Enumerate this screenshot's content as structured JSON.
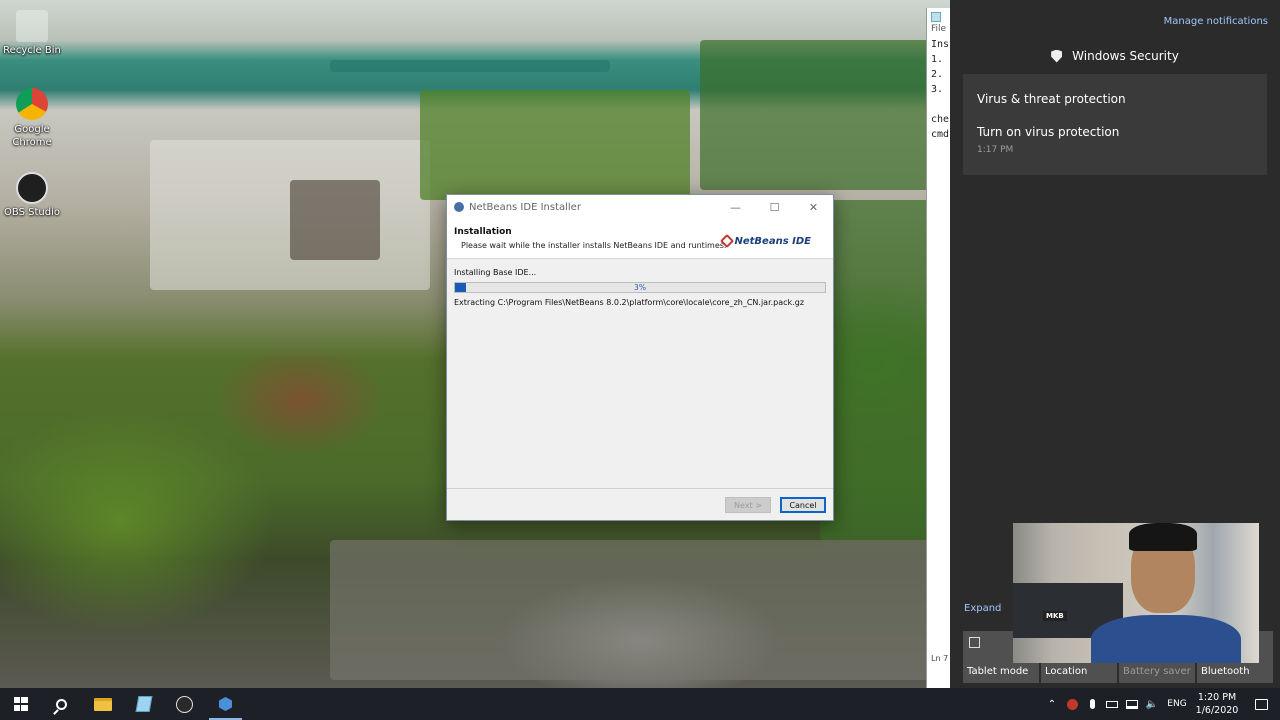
{
  "desktop": {
    "icons": [
      {
        "label": "Recycle Bin"
      },
      {
        "label": "Google Chrome"
      },
      {
        "label": "OBS Studio"
      }
    ]
  },
  "notepad": {
    "lines": [
      "File",
      "Ins",
      "1.",
      "2.",
      "3.",
      "",
      "che",
      "cmd"
    ],
    "status": "Ln 7"
  },
  "installer": {
    "title": "NetBeans IDE Installer",
    "header_title": "Installation",
    "header_subtitle": "Please wait while the installer installs NetBeans IDE and runtimes.",
    "logo_text": "NetBeans IDE",
    "status": "Installing Base IDE...",
    "progress_percent": 3,
    "progress_label": "3%",
    "detail": "Extracting C:\\Program Files\\NetBeans 8.0.2\\platform\\core\\locale\\core_zh_CN.jar.pack.gz",
    "next_label": "Next >",
    "cancel_label": "Cancel"
  },
  "action_center": {
    "manage_label": "Manage notifications",
    "app_name": "Windows Security",
    "notification_title": "Virus & threat protection",
    "notification_body": "Turn on virus protection",
    "notification_time": "1:17 PM",
    "expand_label": "Expand",
    "quick_actions": [
      {
        "label": "Tablet mode",
        "enabled": true
      },
      {
        "label": "Location",
        "enabled": true
      },
      {
        "label": "Battery saver",
        "enabled": false
      },
      {
        "label": "Bluetooth",
        "enabled": true
      }
    ]
  },
  "webcam": {
    "tag": "MKB"
  },
  "taskbar": {
    "language": "ENG",
    "time": "1:20 PM",
    "date": "1/6/2020"
  },
  "colors": {
    "accent": "#0a64c9",
    "progress": "#1a5bb8",
    "action_center_bg": "#2b2b2b",
    "link": "#9fc6ff"
  }
}
